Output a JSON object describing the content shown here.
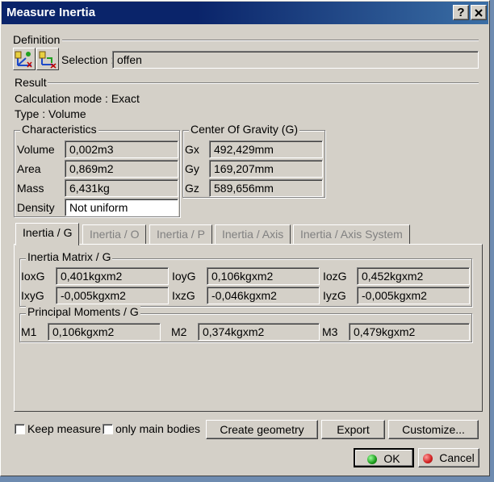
{
  "window": {
    "title": "Measure Inertia",
    "help_label": "?",
    "close_label": "X"
  },
  "definition": {
    "heading": "Definition",
    "selection_label": "Selection :",
    "selection_value": "offen"
  },
  "result": {
    "heading": "Result",
    "calc_mode": "Calculation mode :  Exact",
    "type": "Type :  Volume"
  },
  "characteristics": {
    "title": "Characteristics",
    "rows": [
      {
        "label": "Volume",
        "value": "0,002m3"
      },
      {
        "label": "Area",
        "value": "0,869m2"
      },
      {
        "label": "Mass",
        "value": "6,431kg"
      },
      {
        "label": "Density",
        "value": "Not uniform"
      }
    ]
  },
  "cog": {
    "title": "Center Of Gravity (G)",
    "rows": [
      {
        "label": "Gx",
        "value": "492,429mm"
      },
      {
        "label": "Gy",
        "value": "169,207mm"
      },
      {
        "label": "Gz",
        "value": "589,656mm"
      }
    ]
  },
  "tabs": [
    {
      "label": "Inertia / G",
      "active": true
    },
    {
      "label": "Inertia / O",
      "active": false
    },
    {
      "label": "Inertia / P",
      "active": false
    },
    {
      "label": "Inertia / Axis",
      "active": false
    },
    {
      "label": "Inertia / Axis System",
      "active": false
    }
  ],
  "inertia_matrix": {
    "title": "Inertia Matrix / G",
    "cells": [
      {
        "label": "IoxG",
        "value": "0,401kgxm2"
      },
      {
        "label": "IoyG",
        "value": "0,106kgxm2"
      },
      {
        "label": "IozG",
        "value": "0,452kgxm2"
      },
      {
        "label": "IxyG",
        "value": "-0,005kgxm2"
      },
      {
        "label": "IxzG",
        "value": "-0,046kgxm2"
      },
      {
        "label": "IyzG",
        "value": "-0,005kgxm2"
      }
    ]
  },
  "principal_moments": {
    "title": "Principal Moments / G",
    "cells": [
      {
        "label": "M1",
        "value": "0,106kgxm2"
      },
      {
        "label": "M2",
        "value": "0,374kgxm2"
      },
      {
        "label": "M3",
        "value": "0,479kgxm2"
      }
    ]
  },
  "options": {
    "keep_measure": "Keep measure",
    "only_main_bodies": "only main bodies"
  },
  "buttons": {
    "create_geometry": "Create geometry",
    "export": "Export",
    "customize": "Customize...",
    "ok": "OK",
    "cancel": "Cancel"
  },
  "colors": {
    "title_bar": "#0a246a",
    "dialog_bg": "#d4d0c8",
    "ok_icon": "#1a9a1a",
    "cancel_icon": "#d02020"
  }
}
